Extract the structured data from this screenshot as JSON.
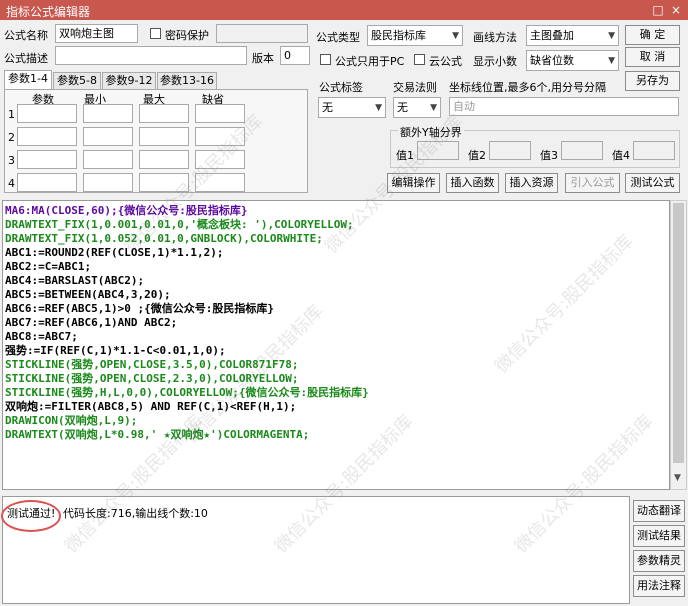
{
  "window": {
    "title": "指标公式编辑器",
    "restore": "□",
    "close": "×"
  },
  "form": {
    "name_label": "公式名称",
    "name_value": "双响炮主图",
    "pwd_label": "密码保护",
    "desc_label": "公式描述",
    "version_label": "版本",
    "version_value": "0",
    "type_label": "公式类型",
    "type_value": "股民指标库",
    "draw_label": "画线方法",
    "draw_value": "主图叠加",
    "pc_only_label": "公式只用于PC",
    "cloud_label": "云公式",
    "decimals_label": "显示小数",
    "decimals_value": "缺省位数",
    "formula_tag_label": "公式标签",
    "trade_rule_label": "交易法则",
    "coord_label": "坐标线位置,最多6个,用分号分隔",
    "formula_tag_value": "无",
    "trade_rule_value": "无",
    "coord_placeholder": "自动",
    "y_axis_label": "额外Y轴分界",
    "y_values": [
      "值1",
      "值2",
      "值3",
      "值4"
    ]
  },
  "buttons": {
    "ok": "确 定",
    "cancel": "取 消",
    "save_as": "另存为",
    "edit_op": "编辑操作",
    "insert_func": "插入函数",
    "insert_res": "插入资源",
    "import": "引入公式",
    "test": "测试公式"
  },
  "tabs": [
    "参数1-4",
    "参数5-8",
    "参数9-12",
    "参数13-16"
  ],
  "params": {
    "headers": [
      "参数",
      "最小",
      "最大",
      "缺省"
    ],
    "rows": [
      "1",
      "2",
      "3",
      "4"
    ]
  },
  "code_lines": [
    "MA6:MA(CLOSE,60);{微信公众号:股民指标库}",
    "DRAWTEXT_FIX(1,0.001,0.01,0,'概念板块: '),COLORYELLOW;",
    "DRAWTEXT_FIX(1,0.052,0.01,0,GNBLOCK),COLORWHITE;",
    "ABC1:=ROUND2(REF(CLOSE,1)*1.1,2);",
    "ABC2:=C=ABC1;",
    "ABC4:=BARSLAST(ABC2);",
    "ABC5:=BETWEEN(ABC4,3,20);",
    "ABC6:=REF(ABC5,1)>0 ;{微信公众号:股民指标库}",
    "ABC7:=REF(ABC6,1)AND ABC2;",
    "ABC8:=ABC7;",
    "强势:=IF(REF(C,1)*1.1-C<0.01,1,0);",
    "STICKLINE(强势,OPEN,CLOSE,3.5,0),COLOR871F78;",
    "STICKLINE(强势,OPEN,CLOSE,2.3,0),COLORYELLOW;",
    "STICKLINE(强势,H,L,0,0),COLORYELLOW;{微信公众号:股民指标库}",
    "双响炮:=FILTER(ABC8,5) AND REF(C,1)<REF(H,1);",
    "DRAWICON(双响炮,L,9);",
    "DRAWTEXT(双响炮,L*0.98,' ★双响炮★')COLORMAGENTA;"
  ],
  "status": {
    "test_ok": "测试通过!",
    "info": "代码长度:716,输出线个数:10"
  },
  "side_buttons": [
    "动态翻译",
    "测试结果",
    "参数精灵",
    "用法注释"
  ],
  "watermark": "微信公众号:股民指标库",
  "colors": {
    "title_bar": "#c8574e",
    "circle": "#d9534f"
  }
}
